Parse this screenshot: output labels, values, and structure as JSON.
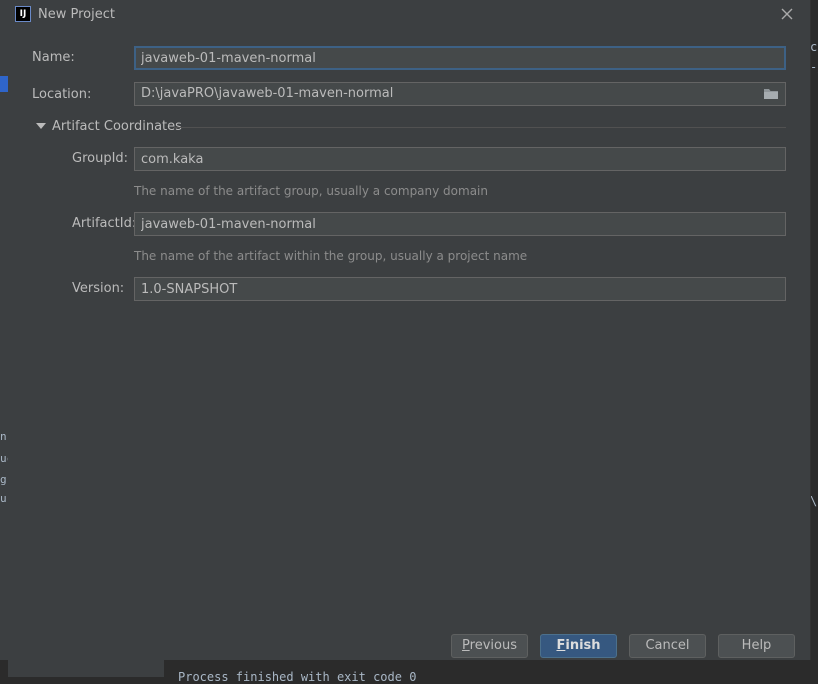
{
  "dialog": {
    "title": "New Project",
    "app_icon_text": "IJ"
  },
  "form": {
    "name_label": "Name:",
    "name_value": "javaweb-01-maven-normal",
    "location_label": "Location:",
    "location_value": "D:\\javaPRO\\javaweb-01-maven-normal"
  },
  "artifact": {
    "section_title": "Artifact Coordinates",
    "groupid_label": "GroupId:",
    "groupid_value": "com.kaka",
    "groupid_hint": "The name of the artifact group, usually a company domain",
    "artifactid_label": "ArtifactId:",
    "artifactid_value": "javaweb-01-maven-normal",
    "artifactid_hint": "The name of the artifact within the group, usually a project name",
    "version_label": "Version:",
    "version_value": "1.0-SNAPSHOT"
  },
  "buttons": {
    "previous_mnemonic": "P",
    "previous_rest": "revious",
    "finish_mnemonic": "F",
    "finish_rest": "inish",
    "cancel": "Cancel",
    "help": "Help"
  },
  "background": {
    "console_text": "Process finished with exit code 0",
    "left_fragments": [
      "n:",
      "uc",
      "g",
      "ur"
    ],
    "right_fragments": [
      "c",
      "-/",
      "\\"
    ]
  },
  "colors": {
    "dialog_bg": "#3c3f41",
    "field_bg": "#45494a",
    "focus_border": "#3d6185",
    "primary_button": "#365880"
  }
}
